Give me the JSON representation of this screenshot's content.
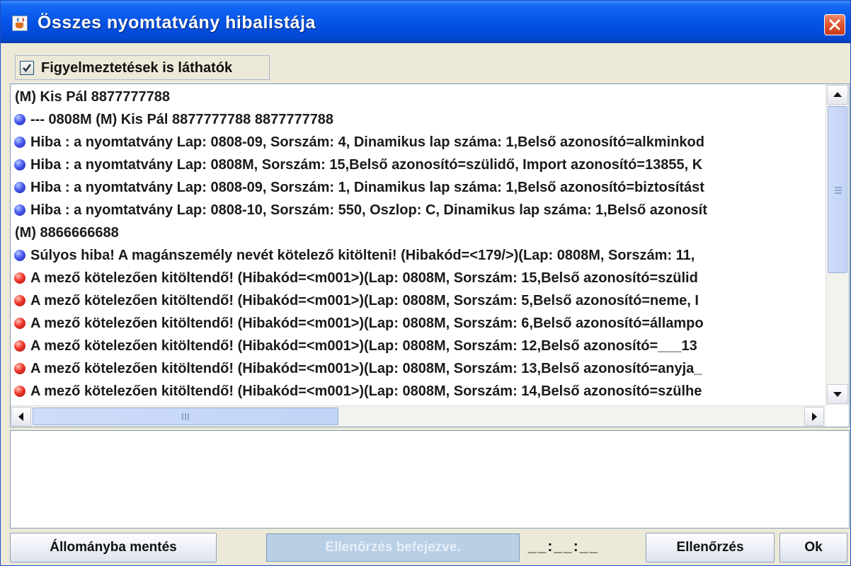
{
  "window": {
    "title": "Összes nyomtatvány hibalistája"
  },
  "options": {
    "show_warnings_label": "Figyelmeztetések is láthatók",
    "show_warnings_checked": true
  },
  "error_list": {
    "rows": [
      {
        "icon": "none",
        "text": "(M) Kis Pál 8877777788"
      },
      {
        "icon": "blue",
        "text": " --- 0808M  (M) Kis Pál 8877777788 8877777788"
      },
      {
        "icon": "blue",
        "text": "Hiba : a nyomtatvány Lap: 0808-09, Sorszám: 4, Dinamikus lap száma: 1,Belső azonosító=alkminkod"
      },
      {
        "icon": "blue",
        "text": "Hiba : a nyomtatvány Lap: 0808M, Sorszám: 15,Belső azonosító=szülidő, Import azonosító=13855, K"
      },
      {
        "icon": "blue",
        "text": "Hiba : a nyomtatvány Lap: 0808-09, Sorszám: 1, Dinamikus lap száma: 1,Belső azonosító=biztosítást"
      },
      {
        "icon": "blue",
        "text": "Hiba : a nyomtatvány Lap: 0808-10, Sorszám: 550, Oszlop: C, Dinamikus lap száma: 1,Belső azonosít"
      },
      {
        "icon": "none",
        "text": "(M) 8866666688"
      },
      {
        "icon": "blue",
        "text": "Súlyos hiba! A magánszemély nevét kötelező kitölteni!  (Hibakód=<179/>)(Lap: 0808M, Sorszám: 11,"
      },
      {
        "icon": "red",
        "text": "A mező kötelezően kitöltendő! (Hibakód=<m001>)(Lap: 0808M, Sorszám: 15,Belső azonosító=szülid"
      },
      {
        "icon": "red",
        "text": "A mező kötelezően kitöltendő! (Hibakód=<m001>)(Lap: 0808M, Sorszám: 5,Belső azonosító=neme, I"
      },
      {
        "icon": "red",
        "text": "A mező kötelezően kitöltendő! (Hibakód=<m001>)(Lap: 0808M, Sorszám: 6,Belső azonosító=állampo"
      },
      {
        "icon": "red",
        "text": "A mező kötelezően kitöltendő! (Hibakód=<m001>)(Lap: 0808M, Sorszám: 12,Belső azonosító=___13"
      },
      {
        "icon": "red",
        "text": "A mező kötelezően kitöltendő! (Hibakód=<m001>)(Lap: 0808M, Sorszám: 13,Belső azonosító=anyja_"
      },
      {
        "icon": "red",
        "text": "A mező kötelezően kitöltendő! (Hibakód=<m001>)(Lap: 0808M, Sorszám: 14,Belső azonosító=szülhe"
      }
    ]
  },
  "footer": {
    "save_label": "Állományba mentés",
    "status_label": "Ellenőrzés befejezve.",
    "timer": "__:__:__",
    "check_label": "Ellenőrzés",
    "ok_label": "Ok"
  },
  "icons": {
    "app": "java-cup-icon",
    "close": "close-icon",
    "info_dot": "blue-dot-icon",
    "error_dot": "red-dot-icon"
  },
  "colors": {
    "titlebar": "#0554e6",
    "close_button": "#e2532d",
    "info_dot": "#4a5cf0",
    "error_dot": "#f0382a",
    "status_bar": "#b8cfe6"
  }
}
